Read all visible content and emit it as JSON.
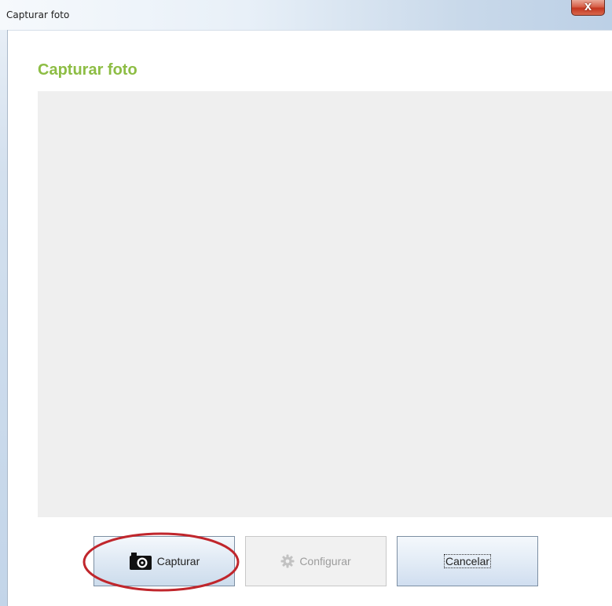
{
  "window": {
    "title": "Capturar foto",
    "close_glyph": "X"
  },
  "dialog": {
    "heading": "Capturar foto",
    "heading_color": "#8dbd44",
    "preview_background": "#efefef"
  },
  "buttons": {
    "capture": {
      "label": "Capturar",
      "icon": "camera-icon",
      "enabled": true
    },
    "configure": {
      "label": "Configurar",
      "icon": "gear-icon",
      "enabled": false
    },
    "cancel": {
      "label": "Cancelar",
      "enabled": true,
      "focused": true
    }
  },
  "annotation": {
    "highlight_color": "#c0262c",
    "highlight_target": "capture-button"
  }
}
